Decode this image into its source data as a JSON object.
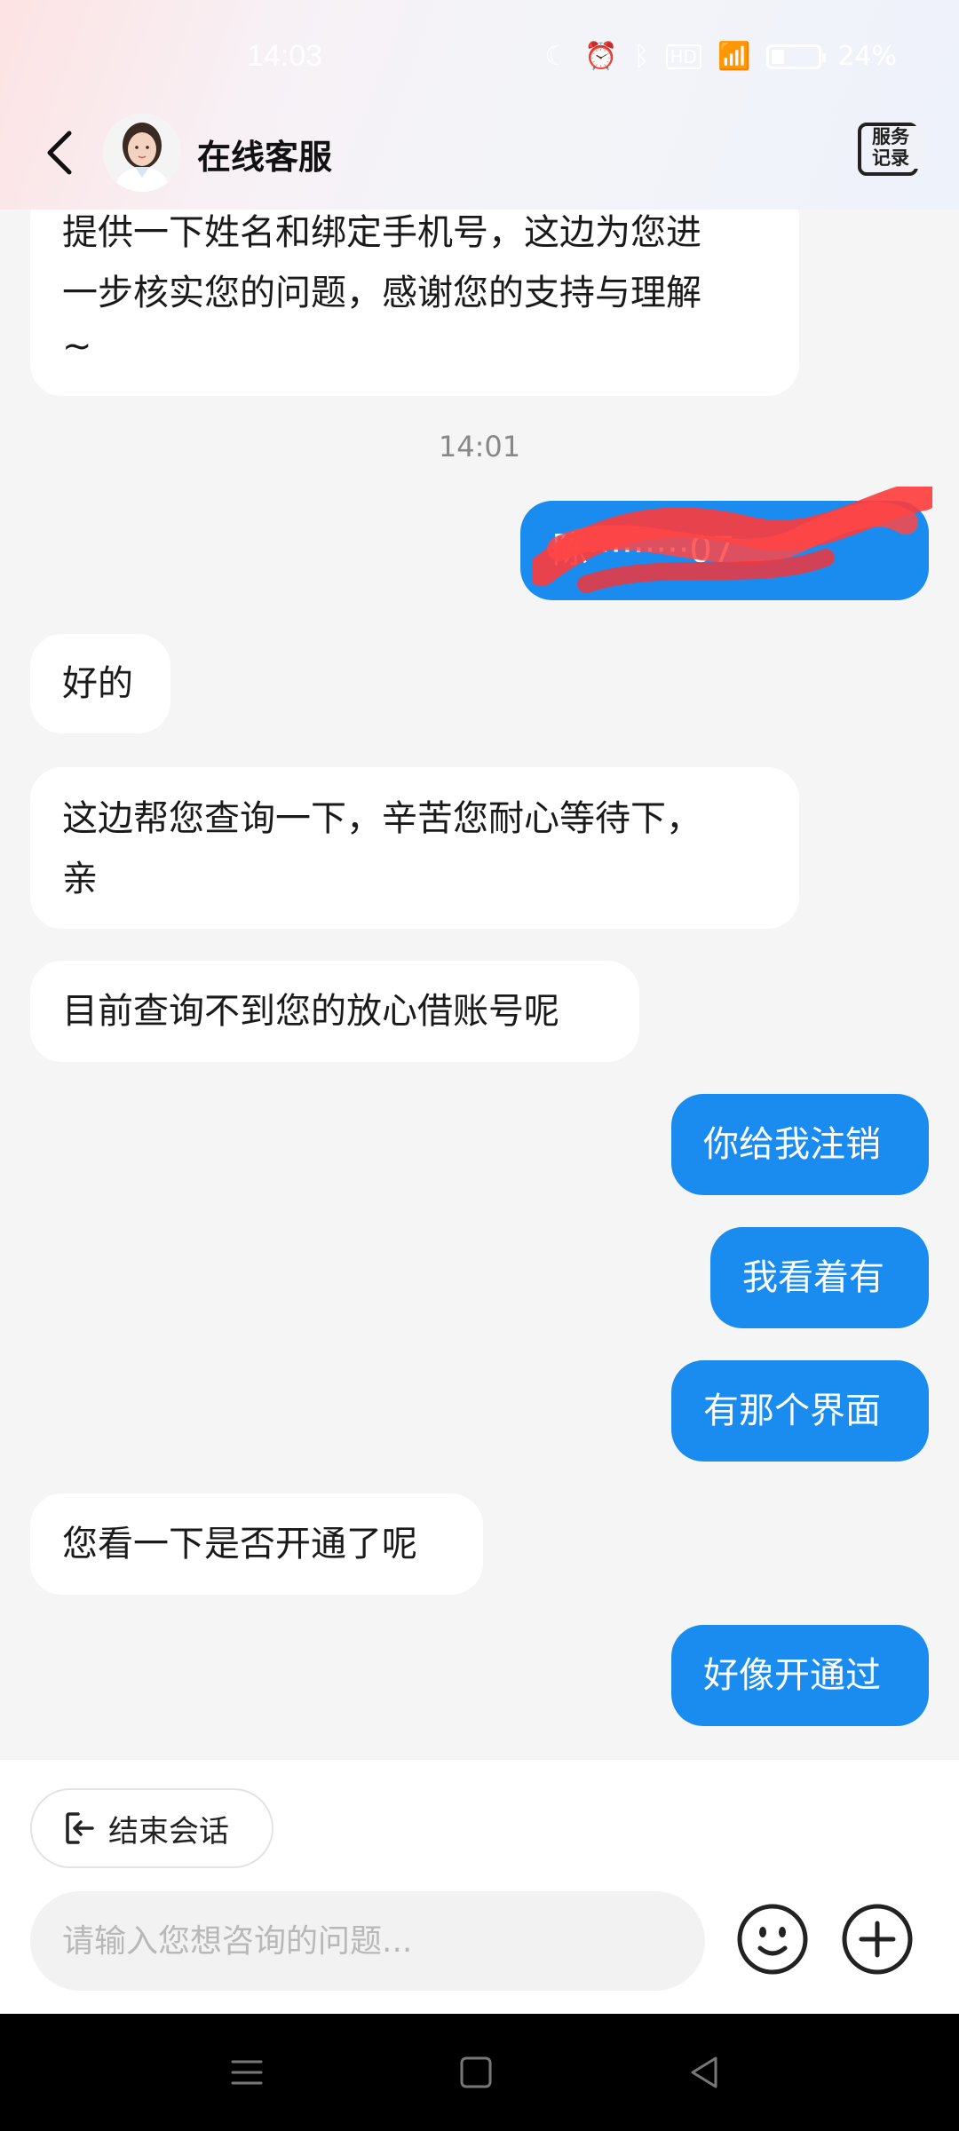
{
  "status_bar": {
    "time": "14:03",
    "battery": "24%"
  },
  "header": {
    "title": "在线客服",
    "service_record_line1": "服务",
    "service_record_line2": "记录"
  },
  "messages": [
    {
      "side": "left",
      "lines": [
        "提供一下姓名和绑定手机号，这边为您进",
        "一步核实您的问题，感谢您的支持与理解",
        "~"
      ]
    },
    {
      "side": "right",
      "text": "陈·········07"
    },
    {
      "side": "left",
      "text": "好的"
    },
    {
      "side": "left",
      "lines": [
        "这边帮您查询一下，辛苦您耐心等待下，",
        "亲"
      ]
    },
    {
      "side": "left",
      "text": "目前查询不到您的放心借账号呢"
    },
    {
      "side": "right",
      "text": "你给我注销"
    },
    {
      "side": "right",
      "text": "我看着有"
    },
    {
      "side": "right",
      "text": "有那个界面"
    },
    {
      "side": "left",
      "text": "您看一下是否开通了呢"
    },
    {
      "side": "right",
      "text": "好像开通过"
    }
  ],
  "timestamp": "14:01",
  "bottom": {
    "end_session_label": "结束会话",
    "input_placeholder": "请输入您想咨询的问题...",
    "input_value": ""
  },
  "colors": {
    "accent": "#1a8cf0",
    "bubble_left": "#ffffff",
    "background": "#f5f5f5"
  }
}
